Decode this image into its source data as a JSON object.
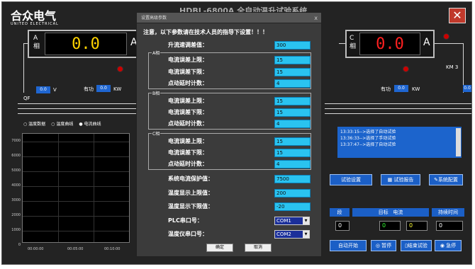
{
  "app": {
    "brand": "合众电气",
    "brand_sub": "UNITED ELECTRICAL",
    "title_partial": "HDBL-6800A 全自动温升试验系统",
    "close_glyph": "✕"
  },
  "meters": {
    "a": {
      "phase_top": "A",
      "phase_bottom": "相",
      "value": "0.0",
      "unit": "A",
      "color": "#ffd400"
    },
    "c": {
      "phase_top": "C",
      "phase_bottom": "相",
      "value": "0.0",
      "unit": "A",
      "color": "#ff2020"
    }
  },
  "left_panel": {
    "small_val": "0.0",
    "unit_v": "V",
    "youdong": "有功",
    "kw": "KW",
    "qf": "QF",
    "small_val2": "0.0"
  },
  "right_panel": {
    "km": "KM 3",
    "youdong": "有功",
    "kw": "KW",
    "small_val": "0.0",
    "unit_v": "V",
    "small_val2": "0.0"
  },
  "chart_tabs": [
    {
      "label": "温度数据",
      "selected": false
    },
    {
      "label": "温度曲线",
      "selected": false
    },
    {
      "label": "电流曲线",
      "selected": true
    }
  ],
  "chart_data": {
    "type": "line",
    "series": [],
    "x_ticks": [
      "00:00:00",
      "00:05:00",
      "00:10:00"
    ],
    "y_ticks": [
      "7000",
      "6000",
      "5000",
      "4000",
      "3000",
      "2000",
      "1000",
      "0"
    ],
    "ylim": [
      0,
      7000
    ]
  },
  "log_lines": [
    "13:33:15-->选择了自动试验",
    "13:36:33-->选择了手动试验",
    "13:37:47-->选择了自动试验"
  ],
  "buttons": {
    "test_setup": "试验设置",
    "test_report": "试验报告",
    "system_config": "系统配置",
    "auto_start": "自动开始",
    "pause": "暂停",
    "end_test": "结束试验",
    "emergency": "急停"
  },
  "table": {
    "headers": [
      "段",
      "目标",
      "电流",
      "持续时间"
    ],
    "values": [
      "0",
      "0",
      "0",
      "0"
    ]
  },
  "dialog": {
    "title": "设置高级参数",
    "close": "x",
    "warning": "注意，以下参数请在技术人员的指导下设置！！！",
    "rise_label": "升流速调差值：",
    "rise_value": "300",
    "groups": [
      {
        "name": "A相",
        "rows": [
          {
            "label": "电流误差上限：",
            "value": "15"
          },
          {
            "label": "电流误差下限：",
            "value": "15"
          },
          {
            "label": "点动延时计数：",
            "value": "4"
          }
        ]
      },
      {
        "name": "B相",
        "rows": [
          {
            "label": "电流误差上限：",
            "value": "15"
          },
          {
            "label": "电流误差下限：",
            "value": "15"
          },
          {
            "label": "点动延时计数：",
            "value": "4"
          }
        ]
      },
      {
        "name": "C相",
        "rows": [
          {
            "label": "电流误差上限：",
            "value": "15"
          },
          {
            "label": "电流误差下限：",
            "value": "15"
          },
          {
            "label": "点动延时计数：",
            "value": "4"
          }
        ]
      }
    ],
    "protect_label": "系统电流保护值：",
    "protect_value": "7500",
    "tmax_label": "温度显示上限值：",
    "tmax_value": "200",
    "tmin_label": "温度显示下限值：",
    "tmin_value": "-20",
    "plc_label": "PLC串口号：",
    "plc_value": "COM1",
    "thermo_label": "温度仪串口号：",
    "thermo_value": "COM2",
    "ok": "确定",
    "cancel": "取消"
  }
}
